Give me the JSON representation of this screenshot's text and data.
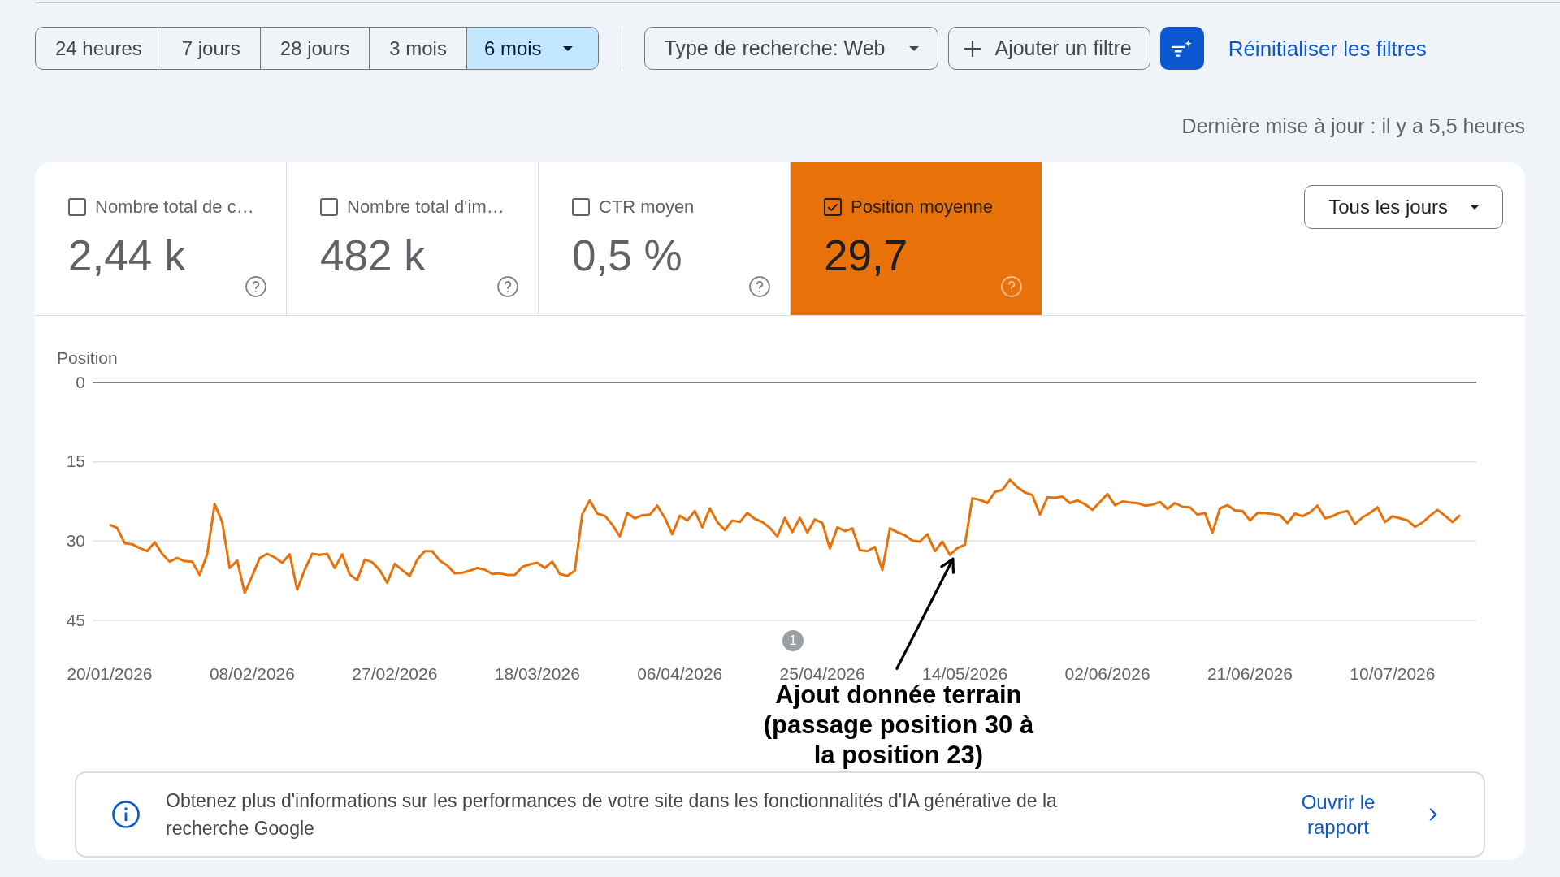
{
  "periods": [
    {
      "label": "24 heures",
      "kind": "option",
      "selected": false
    },
    {
      "label": "7 jours",
      "kind": "option",
      "selected": false
    },
    {
      "label": "28 jours",
      "kind": "option",
      "selected": false
    },
    {
      "label": "3 mois",
      "kind": "option",
      "selected": false
    },
    {
      "label": "6 mois",
      "kind": "dropdown",
      "selected": true
    }
  ],
  "filters": [
    {
      "kind": "dropdown",
      "label": "Type de recherche: Web"
    },
    {
      "kind": "add",
      "label": "Ajouter un filtre"
    }
  ],
  "reset_link": "Réinitialiser les filtres",
  "last_updated": "Dernière mise à jour : il y a 5,5 heures",
  "metrics": [
    {
      "label": "Nombre total de c…",
      "value": "2,44 k",
      "selected": false
    },
    {
      "label": "Nombre total d'im…",
      "value": "482 k",
      "selected": false
    },
    {
      "label": "CTR moyen",
      "value": "0,5 %",
      "selected": false
    },
    {
      "label": "Position moyenne",
      "value": "29,7",
      "selected": true,
      "color": "#e8710a"
    }
  ],
  "granularity_dropdown": {
    "label": "Tous les jours"
  },
  "chart": {
    "chart_data": {
      "type": "line",
      "ylabel": "Position",
      "categories": [
        "20/01/2026",
        null,
        null,
        null,
        null,
        null,
        null,
        null,
        null,
        null,
        null,
        null,
        null,
        null,
        null,
        null,
        null,
        null,
        null,
        "08/02/2026",
        null,
        null,
        null,
        null,
        null,
        null,
        null,
        null,
        null,
        null,
        null,
        null,
        null,
        null,
        null,
        null,
        null,
        null,
        "27/02/2026",
        null,
        null,
        null,
        null,
        null,
        null,
        null,
        null,
        null,
        null,
        null,
        null,
        null,
        null,
        null,
        null,
        null,
        null,
        "18/03/2026",
        null,
        null,
        null,
        null,
        null,
        null,
        null,
        null,
        null,
        null,
        null,
        null,
        null,
        null,
        null,
        null,
        null,
        null,
        "06/04/2026",
        null,
        null,
        null,
        null,
        null,
        null,
        null,
        null,
        null,
        null,
        null,
        null,
        null,
        null,
        null,
        null,
        null,
        null,
        "25/04/2026",
        null,
        null,
        null,
        null,
        null,
        null,
        null,
        null,
        null,
        null,
        null,
        null,
        null,
        null,
        null,
        null,
        null,
        null,
        "14/05/2026",
        null,
        null,
        null,
        null,
        null,
        null,
        null,
        null,
        null,
        null,
        null,
        null,
        null,
        null,
        null,
        null,
        null,
        null,
        "02/06/2026",
        null,
        null,
        null,
        null,
        null,
        null,
        null,
        null,
        null,
        null,
        null,
        null,
        null,
        null,
        null,
        null,
        null,
        null,
        "21/06/2026",
        null,
        null,
        null,
        null,
        null,
        null,
        null,
        null,
        null,
        null,
        null,
        null,
        null,
        null,
        null,
        null,
        null,
        null,
        "10/07/2026",
        null,
        null,
        null,
        null,
        null,
        null,
        null,
        null,
        null
      ],
      "ylim": [
        45,
        0
      ],
      "yticks": [
        0,
        15,
        30,
        45
      ],
      "series": [
        {
          "color": "#e8710a",
          "values": [
            26.9,
            27.5,
            30.4,
            30.6,
            31.3,
            31.9,
            30.2,
            32.4,
            33.9,
            33.2,
            33.8,
            33.9,
            36.4,
            32.5,
            23.0,
            26.4,
            35.1,
            33.7,
            39.8,
            36.6,
            33.2,
            32.4,
            33.1,
            34.1,
            32.5,
            39.2,
            35.4,
            32.4,
            32.6,
            32.4,
            35.1,
            32.5,
            36.3,
            37.4,
            33.5,
            34.0,
            35.5,
            37.9,
            34.3,
            35.5,
            36.6,
            33.5,
            31.9,
            31.9,
            33.7,
            34.6,
            36.1,
            36.0,
            35.6,
            35.1,
            35.4,
            36.2,
            36.1,
            36.4,
            36.4,
            34.9,
            34.4,
            34.1,
            35.1,
            33.9,
            36.2,
            36.6,
            35.6,
            24.9,
            22.3,
            24.8,
            25.2,
            26.9,
            29.1,
            24.7,
            25.7,
            25.1,
            25.0,
            23.3,
            25.6,
            28.7,
            25.2,
            26.1,
            24.3,
            27.4,
            23.8,
            26.4,
            27.9,
            26.1,
            26.4,
            24.7,
            25.8,
            26.4,
            27.5,
            29.1,
            25.6,
            28.3,
            25.6,
            28.4,
            25.9,
            26.6,
            31.4,
            27.4,
            28.1,
            27.6,
            31.7,
            31.9,
            31.1,
            35.5,
            27.6,
            28.3,
            28.9,
            29.9,
            30.1,
            28.7,
            31.9,
            30.1,
            32.6,
            31.3,
            30.7,
            21.9,
            22.2,
            22.8,
            20.7,
            20.3,
            18.4,
            19.8,
            20.8,
            21.3,
            25.0,
            21.7,
            21.8,
            21.6,
            22.8,
            22.3,
            23.0,
            24.1,
            22.6,
            21.1,
            23.2,
            22.5,
            22.7,
            22.8,
            23.3,
            23.1,
            22.6,
            23.9,
            22.8,
            23.5,
            23.6,
            25.0,
            24.7,
            28.4,
            23.8,
            23.2,
            24.2,
            24.3,
            26.1,
            24.7,
            24.7,
            24.9,
            25.1,
            26.6,
            24.8,
            25.3,
            24.6,
            23.3,
            25.7,
            25.3,
            24.6,
            24.3,
            26.8,
            25.5,
            24.7,
            23.6,
            26.4,
            25.3,
            25.7,
            26.1,
            27.3,
            26.5,
            25.2,
            24.1,
            25.2,
            26.4,
            25.1
          ]
        }
      ],
      "annotations": [
        "1",
        "Ajout donnée terrain (passage position 30 à la position 23)"
      ]
    }
  },
  "info_banner": {
    "text": "Obtenez plus d'informations sur les performances de votre site dans les fonctionnalités d'IA générative de la recherche Google",
    "link": "Ouvrir le rapport"
  }
}
